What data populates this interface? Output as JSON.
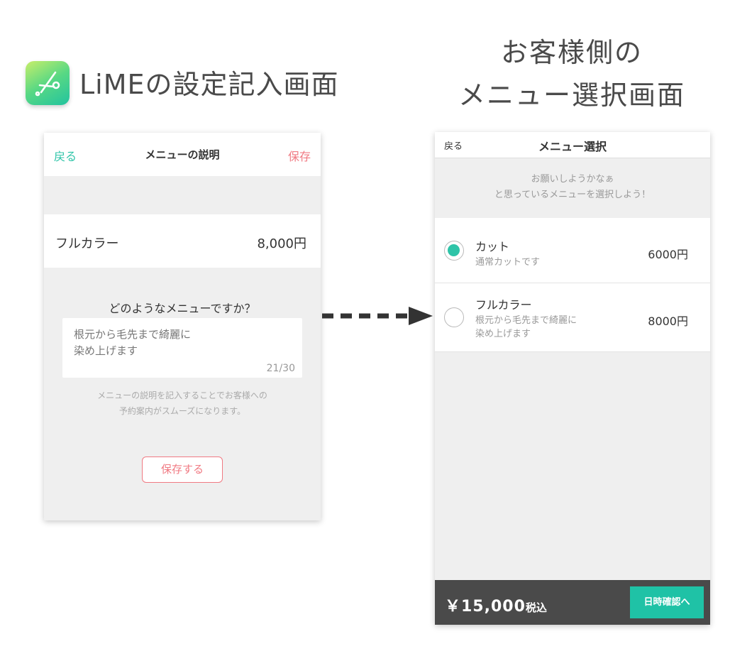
{
  "headings": {
    "left": "LiMEの設定記入画面",
    "right_line1": "お客様側の",
    "right_line2": "メニュー選択画面",
    "app_icon": "scissors-icon"
  },
  "left_screen": {
    "back_label": "戻る",
    "title": "メニューの説明",
    "save_label": "保存",
    "menu_name": "フルカラー",
    "menu_price": "8,000円",
    "question": "どのようなメニューですか？",
    "description_value": "根元から毛先まで綺麗に\n染め上げます",
    "char_count": "21/30",
    "note_line1": "メニューの説明を記入することでお客様への",
    "note_line2": "予約案内がスムーズになります。",
    "save_button": "保存する"
  },
  "right_screen": {
    "back_label": "戻る",
    "title": "メニュー選択",
    "prompt_line1": "お願いしようかなぁ",
    "prompt_line2": "と思っているメニューを選択しよう！",
    "items": [
      {
        "name": "カット",
        "desc_line1": "通常カットです",
        "desc_line2": "",
        "price": "6000円",
        "selected": true
      },
      {
        "name": "フルカラー",
        "desc_line1": "根元から毛先まで綺麗に",
        "desc_line2": "染め上げます",
        "price": "8000円",
        "selected": false
      }
    ],
    "total_amount": "￥15,000",
    "total_tax": "税込",
    "confirm_button": "日時確認へ"
  },
  "colors": {
    "accent": "#2ec4a8",
    "save_red": "#f07a83",
    "footer": "#4a4a4a"
  }
}
